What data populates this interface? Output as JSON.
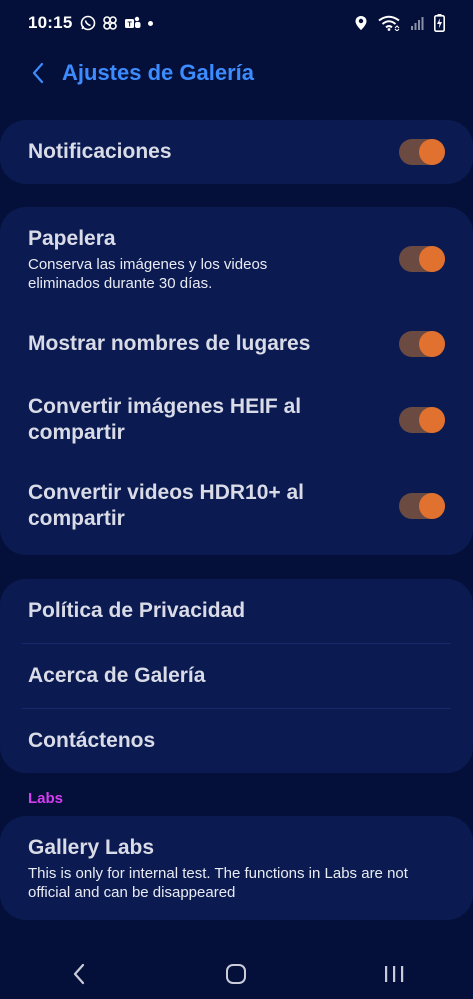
{
  "status_bar": {
    "time": "10:15",
    "left_icons": [
      "whatsapp-icon",
      "connections-icon",
      "teams-icon",
      "notification-dot"
    ],
    "right_icons": [
      "location-icon",
      "wifi-icon",
      "signal-icon",
      "battery-charging-icon"
    ]
  },
  "header": {
    "title": "Ajustes de Galería",
    "back_icon": "chevron-left-icon"
  },
  "notifications": {
    "title": "Notificaciones",
    "enabled": true
  },
  "settings": {
    "trash": {
      "title": "Papelera",
      "subtitle": "Conserva las imágenes y los videos eliminados durante 30 días.",
      "enabled": true
    },
    "place_names": {
      "title": "Mostrar nombres de lugares",
      "enabled": true
    },
    "heif": {
      "title": "Convertir imágenes HEIF al compartir",
      "enabled": true
    },
    "hdr10": {
      "title": "Convertir videos HDR10+ al compartir",
      "enabled": true
    }
  },
  "info": {
    "privacy": "Política de Privacidad",
    "about": "Acerca de Galería",
    "contact": "Contáctenos"
  },
  "labs": {
    "section_label": "Labs",
    "title": "Gallery Labs",
    "subtitle": "This is only for internal test. The functions in Labs are not official and can be disappeared"
  },
  "colors": {
    "accent_blue": "#3d8cff",
    "toggle_on": "#e0712f",
    "labs_label": "#d63df0",
    "background": "#04103a",
    "card": "#0b1b52"
  },
  "nav_bar": [
    "back-nav-icon",
    "home-nav-icon",
    "recents-nav-icon"
  ]
}
